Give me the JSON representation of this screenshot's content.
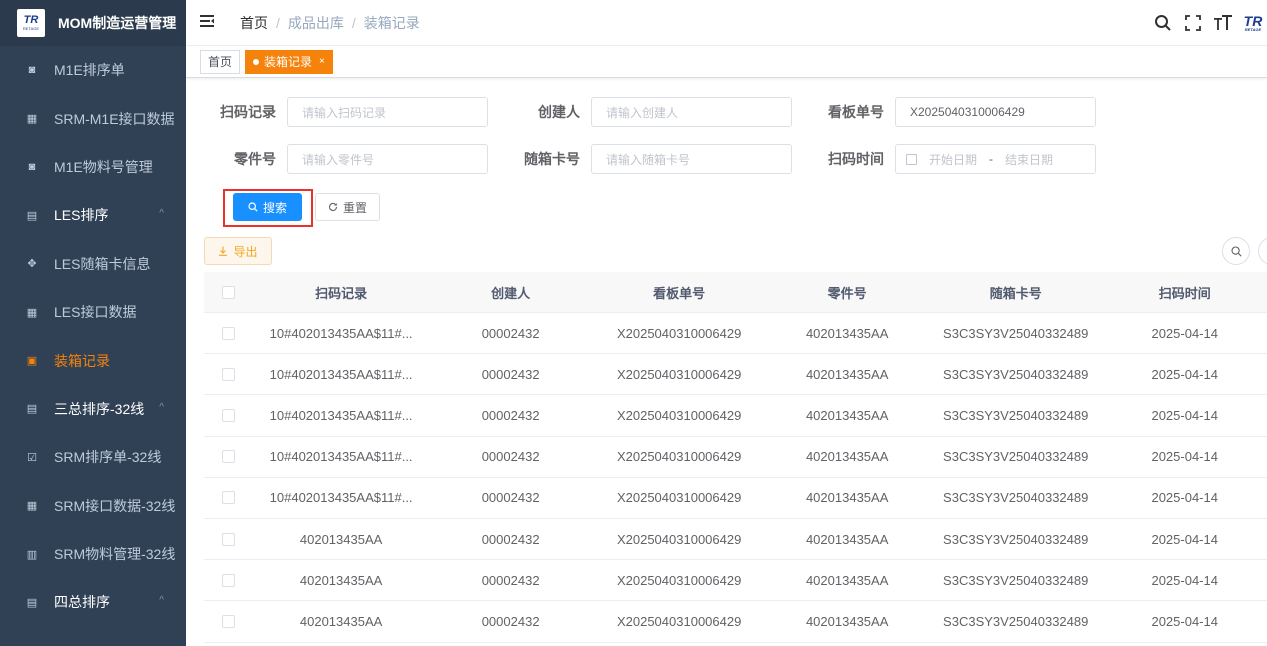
{
  "app": {
    "title": "MOM制造运营管理",
    "logo_text": "TR",
    "logo_sub": "RETAGE"
  },
  "sidebar": {
    "items": [
      {
        "label": "M1E排序单",
        "icon": "doc-icon"
      },
      {
        "label": "SRM-M1E接口数据",
        "icon": "grid-icon"
      },
      {
        "label": "M1E物料号管理",
        "icon": "doc-icon"
      },
      {
        "label": "LES排序",
        "icon": "folder-icon",
        "chevron": "^"
      },
      {
        "label": "LES随箱卡信息",
        "icon": "puzzle-icon"
      },
      {
        "label": "LES接口数据",
        "icon": "grid-icon"
      },
      {
        "label": "装箱记录",
        "icon": "box-icon"
      },
      {
        "label": "三总排序-32线",
        "icon": "folder-icon",
        "chevron": "^"
      },
      {
        "label": "SRM排序单-32线",
        "icon": "check-icon"
      },
      {
        "label": "SRM接口数据-32线",
        "icon": "grid-icon"
      },
      {
        "label": "SRM物料管理-32线",
        "icon": "list-icon"
      },
      {
        "label": "四总排序",
        "icon": "folder-icon",
        "chevron": "^"
      }
    ]
  },
  "header": {
    "breadcrumb": [
      "首页",
      "成品出库",
      "装箱记录"
    ],
    "separator": "/"
  },
  "tags": {
    "home": "首页",
    "active": "装箱记录",
    "close": "×"
  },
  "form": {
    "scan_record": {
      "label": "扫码记录",
      "placeholder": "请输入扫码记录"
    },
    "creator": {
      "label": "创建人",
      "placeholder": "请输入创建人"
    },
    "kanban_no": {
      "label": "看板单号",
      "value": "X2025040310006429"
    },
    "part_no": {
      "label": "零件号",
      "placeholder": "请输入零件号"
    },
    "card_no": {
      "label": "随箱卡号",
      "placeholder": "请输入随箱卡号"
    },
    "scan_time": {
      "label": "扫码时间",
      "start_placeholder": "开始日期",
      "separator": "-",
      "end_placeholder": "结束日期"
    },
    "search_label": "搜索",
    "reset_label": "重置",
    "export_label": "导出"
  },
  "table": {
    "headers": [
      "扫码记录",
      "创建人",
      "看板单号",
      "零件号",
      "随箱卡号",
      "扫码时间"
    ],
    "rows": [
      [
        "10#402013435AA$11#...",
        "00002432",
        "X2025040310006429",
        "402013435AA",
        "S3C3SY3V25040332489",
        "2025-04-14"
      ],
      [
        "10#402013435AA$11#...",
        "00002432",
        "X2025040310006429",
        "402013435AA",
        "S3C3SY3V25040332489",
        "2025-04-14"
      ],
      [
        "10#402013435AA$11#...",
        "00002432",
        "X2025040310006429",
        "402013435AA",
        "S3C3SY3V25040332489",
        "2025-04-14"
      ],
      [
        "10#402013435AA$11#...",
        "00002432",
        "X2025040310006429",
        "402013435AA",
        "S3C3SY3V25040332489",
        "2025-04-14"
      ],
      [
        "10#402013435AA$11#...",
        "00002432",
        "X2025040310006429",
        "402013435AA",
        "S3C3SY3V25040332489",
        "2025-04-14"
      ],
      [
        "402013435AA",
        "00002432",
        "X2025040310006429",
        "402013435AA",
        "S3C3SY3V25040332489",
        "2025-04-14"
      ],
      [
        "402013435AA",
        "00002432",
        "X2025040310006429",
        "402013435AA",
        "S3C3SY3V25040332489",
        "2025-04-14"
      ],
      [
        "402013435AA",
        "00002432",
        "X2025040310006429",
        "402013435AA",
        "S3C3SY3V25040332489",
        "2025-04-14"
      ]
    ]
  },
  "colors": {
    "accent": "#f5820b",
    "primary": "#1890ff",
    "sidebar": "#304156",
    "highlight": "#e7332c"
  }
}
